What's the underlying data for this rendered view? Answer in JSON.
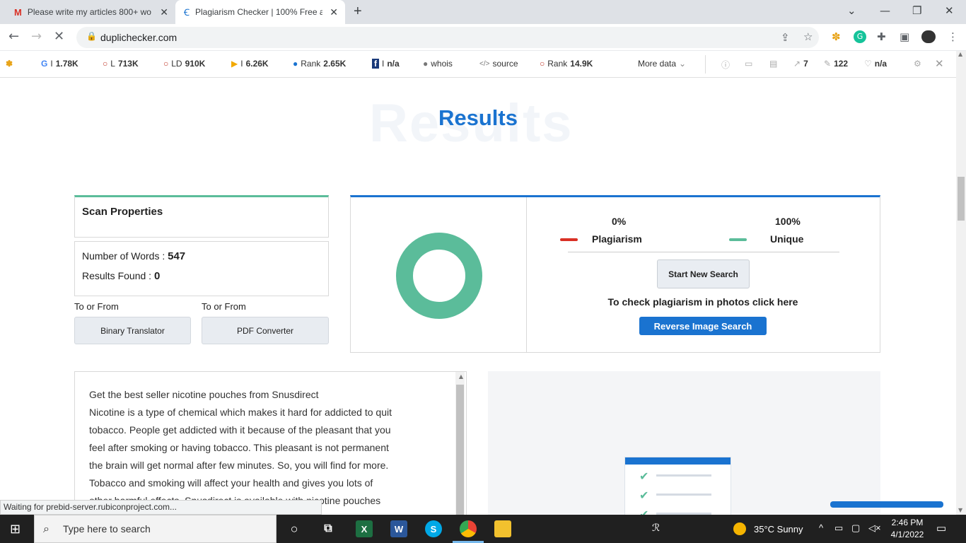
{
  "tabs": [
    {
      "title": "Please write my articles 800+ wo",
      "icon": "gmail-icon"
    },
    {
      "title": "Plagiarism Checker | 100% Free a",
      "icon": "duplichecker-icon"
    }
  ],
  "address": {
    "url": "duplichecker.com"
  },
  "seo_bar": {
    "items": [
      {
        "prefix": "G",
        "label": "I",
        "value": "1.78K"
      },
      {
        "prefix": "○",
        "label": "L",
        "value": "713K"
      },
      {
        "prefix": "○",
        "label": "LD",
        "value": "910K"
      },
      {
        "prefix": "▶",
        "label": "I",
        "value": "6.26K"
      },
      {
        "prefix": "●",
        "label": "Rank",
        "value": "2.65K"
      },
      {
        "prefix": "f",
        "label": "I",
        "value": "n/a"
      },
      {
        "prefix": "👤",
        "label": "whois",
        "value": ""
      },
      {
        "prefix": "</>",
        "label": "source",
        "value": ""
      },
      {
        "prefix": "○",
        "label": "Rank",
        "value": "14.9K"
      }
    ],
    "more": "More data",
    "right": [
      {
        "value": "7"
      },
      {
        "value": "122"
      },
      {
        "value": "n/a"
      }
    ]
  },
  "page": {
    "watermark": "Results",
    "title": "Results",
    "scan_properties": "Scan Properties",
    "words_label": "Number of Words : ",
    "words_value": "547",
    "results_label": "Results Found : ",
    "results_value": "0",
    "to_or_from_1": "To or From",
    "to_or_from_2": "To or From",
    "binary_btn": "Binary Translator",
    "pdf_btn": "PDF Converter",
    "plag_pct": "0%",
    "plag_label": "Plagiarism",
    "unique_pct": "100%",
    "unique_label": "Unique",
    "start_btn": "Start New Search",
    "photo_hint": "To check plagiarism in photos click here",
    "reverse_btn": "Reverse Image Search",
    "plag_color": "#d93025",
    "unique_color": "#5bbc9a",
    "text_lines": [
      "Get the best seller nicotine pouches from Snusdirect",
      "Nicotine is a type of chemical which makes it hard for addicted to quit",
      "tobacco. People get addicted with it because of the pleasant that you",
      "feel after smoking or having tobacco. This pleasant is not permanent",
      "the brain will get normal after few minutes. So, you will find for more.",
      "Tobacco and smoking will affect your health and gives you lots of",
      "other harmful effects. Snusdirect is available with nicotine pouches"
    ]
  },
  "status": "Waiting for prebid-server.rubiconproject.com...",
  "taskbar": {
    "search_placeholder": "Type here to search",
    "weather": "35°C  Sunny",
    "time": "2:46 PM",
    "date": "4/1/2022"
  }
}
